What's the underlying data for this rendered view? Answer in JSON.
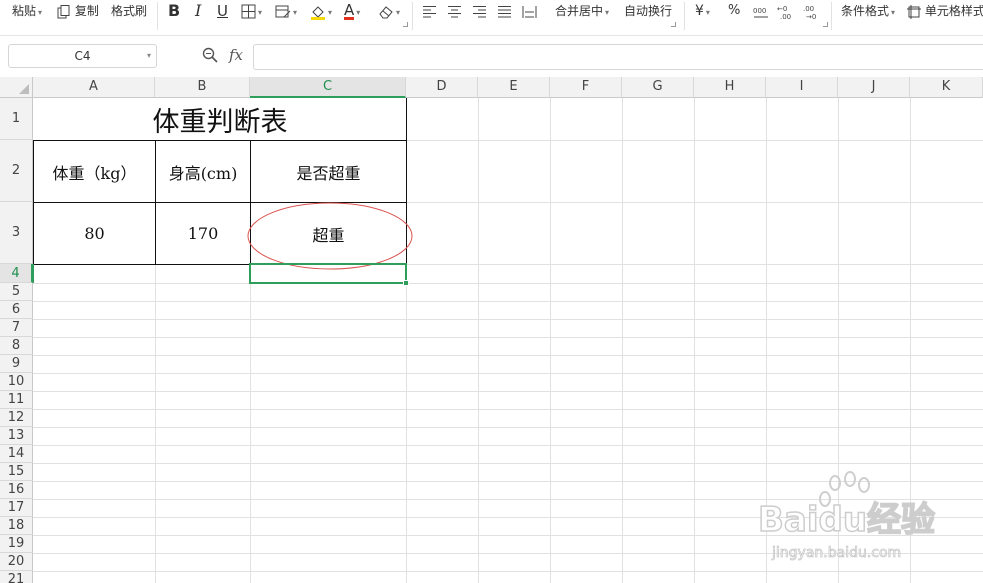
{
  "toolbar": {
    "paste_label": "粘贴",
    "copy_label": "复制",
    "format_painter_label": "格式刷",
    "bold_label": "B",
    "italic_label": "I",
    "underline_label": "U",
    "font_color_label": "A",
    "merge_center_label": "合并居中",
    "wrap_text_label": "自动换行",
    "currency_label": "¥",
    "percent_label": "%",
    "conditional_format_label": "条件格式",
    "cell_style_label": "单元格样式",
    "accent_color": "#2e9e5a",
    "font_color_bar": "#e0301e",
    "fill_color_bar": "#f5d90a"
  },
  "formula_bar": {
    "name_box": "C4",
    "fx_label": "fx",
    "formula_value": ""
  },
  "sheet": {
    "columns": [
      "A",
      "B",
      "C",
      "D",
      "E",
      "F",
      "G",
      "H",
      "I",
      "J",
      "K"
    ],
    "rows": [
      "1",
      "2",
      "3",
      "4",
      "5",
      "6",
      "7",
      "8",
      "9",
      "10",
      "11",
      "12",
      "13",
      "14",
      "15",
      "16",
      "17",
      "18",
      "19",
      "20",
      "21"
    ],
    "selected_cell": "C4",
    "cells": {
      "title": "体重判断表",
      "header_weight": "体重（kg）",
      "header_height": "身高(cm)",
      "header_overweight": "是否超重",
      "weight_value": "80",
      "height_value": "170",
      "result_value": "超重"
    },
    "annotation_color": "#d9534f"
  },
  "watermark": {
    "brand": "Baidu经验",
    "url": "jingyan.baidu.com"
  }
}
